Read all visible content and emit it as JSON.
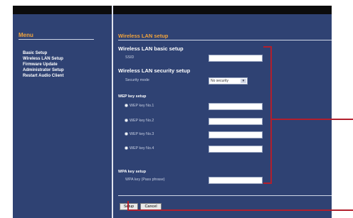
{
  "sidebar": {
    "title": "Menu",
    "items": [
      {
        "label": "Basic Setup"
      },
      {
        "label": "Wireless LAN Setup"
      },
      {
        "label": "Firmware Update"
      },
      {
        "label": "Administrator Setup"
      },
      {
        "label": "Restart Audio Client"
      }
    ]
  },
  "main": {
    "title": "Wireless LAN setup",
    "basic": {
      "heading": "Wireless LAN basic setup",
      "ssid_label": "SSID",
      "ssid_value": ""
    },
    "security": {
      "heading": "Wireless LAN security setup",
      "mode_label": "Security mode",
      "mode_value": "No security"
    },
    "wep": {
      "heading": "WEP key setup",
      "keys": [
        {
          "label": "WEP key No.1",
          "value": ""
        },
        {
          "label": "WEP key No.2",
          "value": ""
        },
        {
          "label": "WEP key No.3",
          "value": ""
        },
        {
          "label": "WEP key No.4",
          "value": ""
        }
      ]
    },
    "wpa": {
      "heading": "WPA key setup",
      "key_label": "WPA key (Pass phrase)",
      "key_value": ""
    },
    "buttons": {
      "setup": "Setup",
      "cancel": "Cancel"
    }
  },
  "colors": {
    "panel": "#2f4273",
    "accent": "#f2a43c",
    "callout": "#b21f2d"
  }
}
